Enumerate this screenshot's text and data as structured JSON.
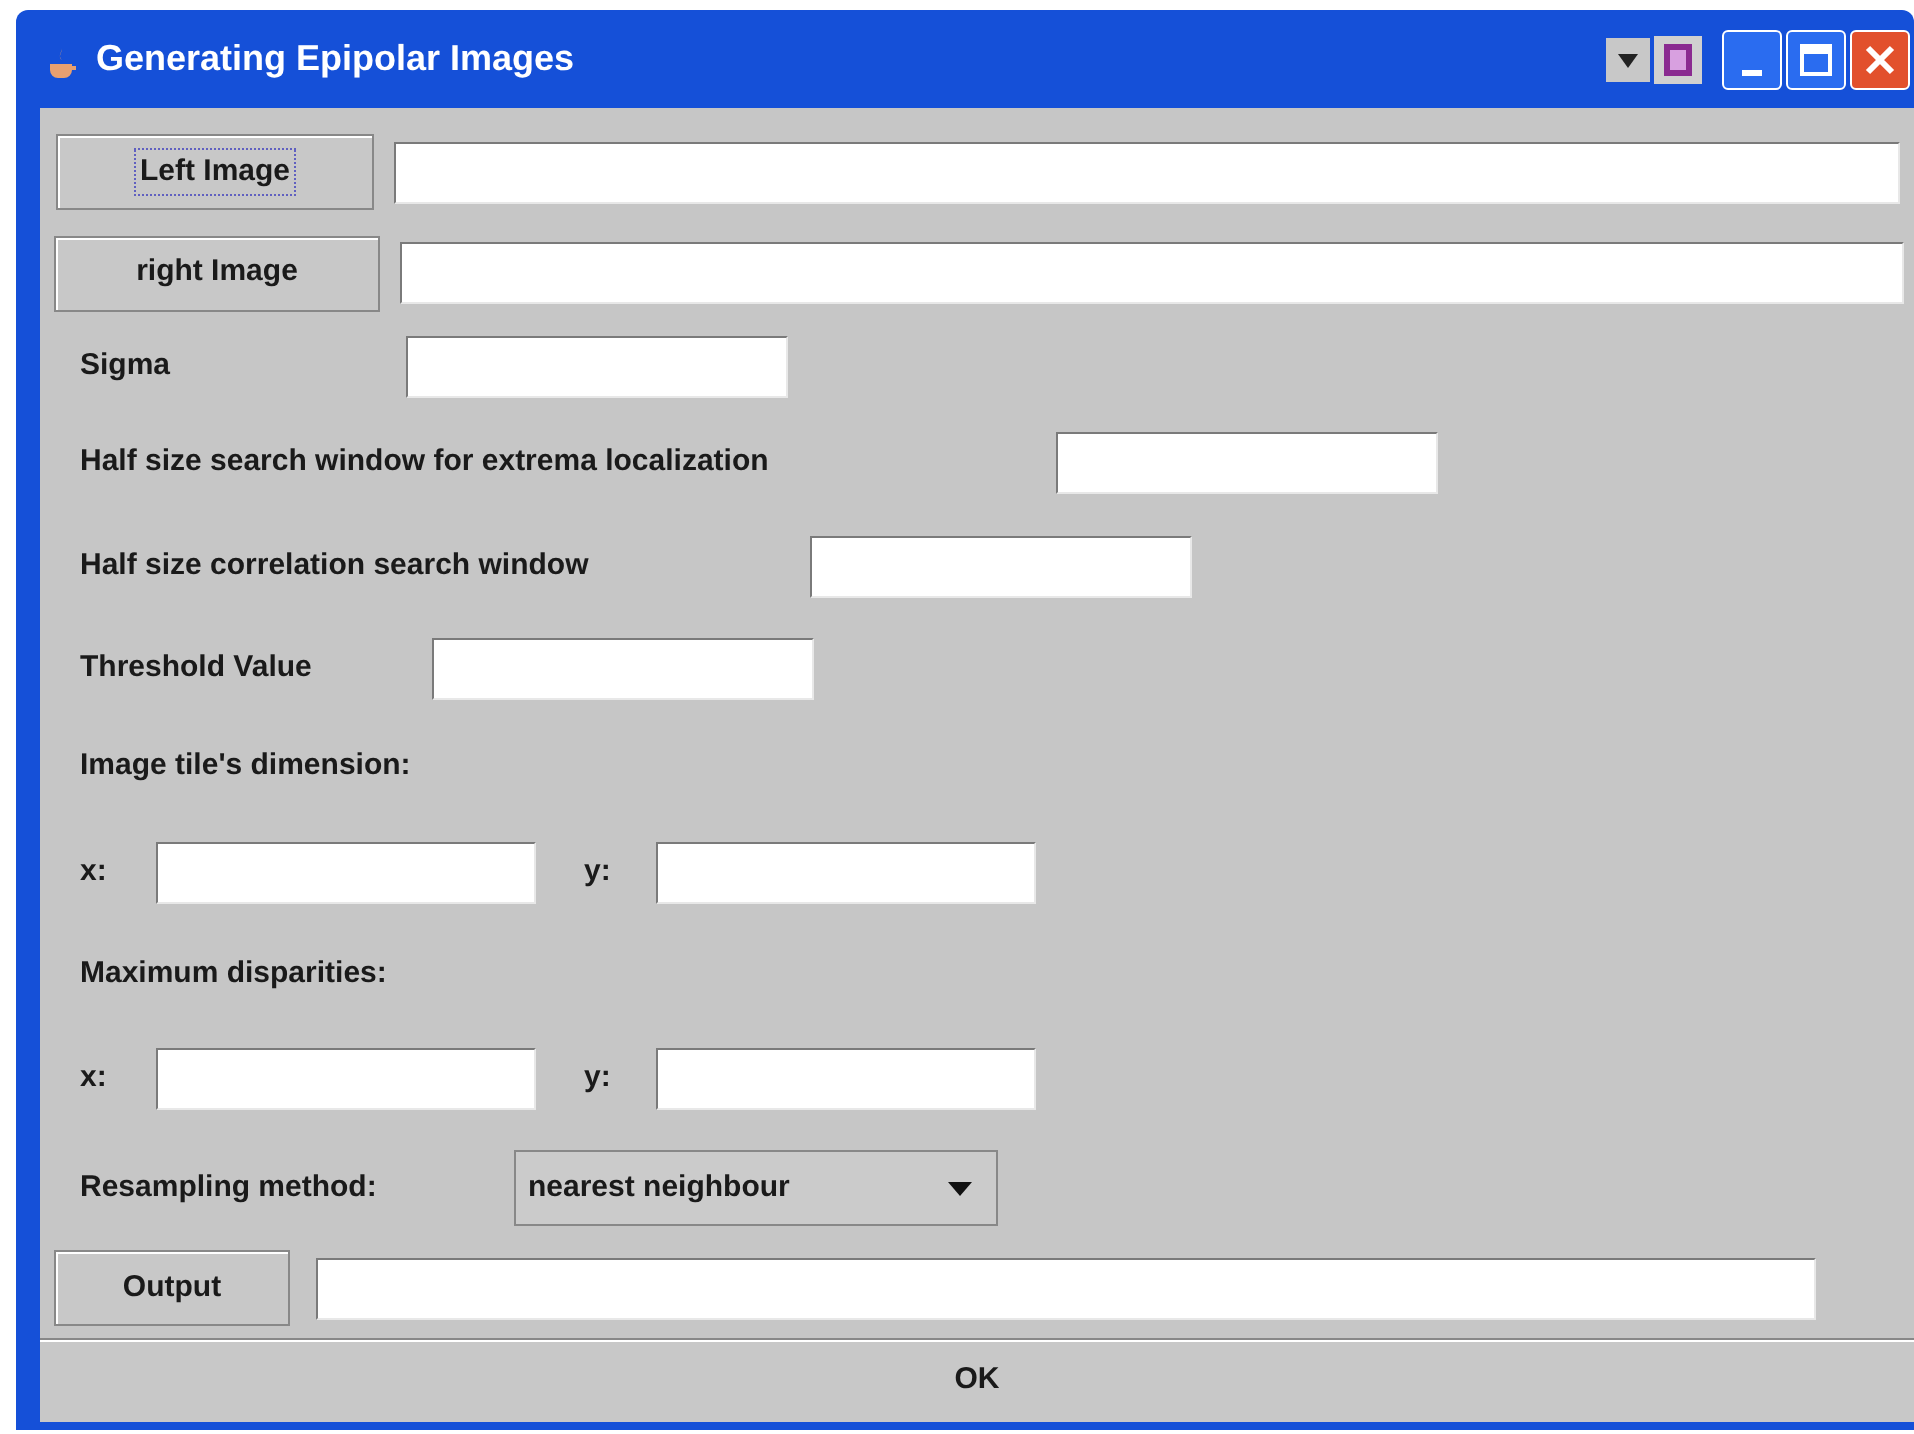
{
  "window": {
    "title": "Generating Epipolar Images"
  },
  "rows": [
    {
      "kind": "file",
      "button": "Left Image",
      "focused": true
    },
    {
      "kind": "file",
      "button": "right Image",
      "focused": false
    },
    {
      "kind": "labeled_field",
      "label": "Sigma"
    },
    {
      "kind": "labeled_field",
      "label": "Half size search window for extrema localization"
    },
    {
      "kind": "labeled_field",
      "label": "Half size correlation search window"
    },
    {
      "kind": "labeled_field",
      "label": "Threshold Value"
    },
    {
      "kind": "heading",
      "label": "Image tile's dimension:"
    },
    {
      "kind": "xy",
      "x_label": "x:",
      "y_label": "y:"
    },
    {
      "kind": "heading",
      "label": "Maximum disparities:"
    },
    {
      "kind": "xy",
      "x_label": "x:",
      "y_label": "y:"
    },
    {
      "kind": "dropdown",
      "label": "Resampling method:",
      "value": "nearest neighbour"
    },
    {
      "kind": "file",
      "button": "Output",
      "focused": false
    }
  ],
  "ok_button": "OK"
}
